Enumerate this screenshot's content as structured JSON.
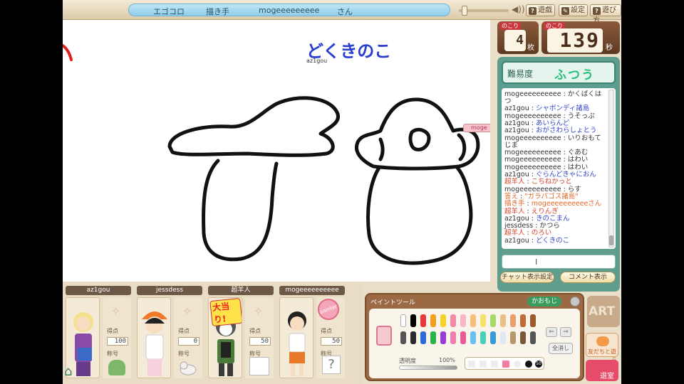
{
  "titlebar": {
    "app": "エゴコロ",
    "role": "描き手",
    "artist": "mogeeeeeeeee",
    "suffix": "さん"
  },
  "toolbar": {
    "help": "遊戯",
    "settings": "設定",
    "howto": "遊び方",
    "help_icon": "?",
    "settings_icon": "✎",
    "howto_icon": "?"
  },
  "counters": {
    "remaining_cards": {
      "caption": "のこり",
      "value": "4",
      "unit": "枚"
    },
    "remaining_time": {
      "caption": "のこり",
      "value": "139",
      "unit": "秒"
    }
  },
  "canvas": {
    "word": "どくきのこ",
    "drawer": "az1gou",
    "peek_tag": "moge"
  },
  "difficulty": {
    "label": "難易度",
    "value": "ふつう"
  },
  "chat": [
    {
      "who": "mogeeeeeeeeee",
      "msg": "かくばくはつ",
      "style": "normal"
    },
    {
      "who": "az1gou",
      "msg": "シャボンディ諸島",
      "style": "blue"
    },
    {
      "who": "mogeeeeeeeeee",
      "msg": "うそっぷ",
      "style": "normal"
    },
    {
      "who": "az1gou",
      "msg": "あいらんど",
      "style": "blue"
    },
    {
      "who": "az1gou",
      "msg": "おがさわらしょとう",
      "style": "blue"
    },
    {
      "who": "mogeeeeeeeeee",
      "msg": "いりおもてじま",
      "style": "normal"
    },
    {
      "who": "mogeeeeeeeeee",
      "msg": "ぐあむ",
      "style": "normal"
    },
    {
      "who": "mogeeeeeeeeee",
      "msg": "はわい",
      "style": "normal"
    },
    {
      "who": "mogeeeeeeeeee",
      "msg": "はわい",
      "style": "normal"
    },
    {
      "who": "az1gou",
      "msg": "ぐらんどきゃにおん",
      "style": "blue"
    },
    {
      "who": "超羊人",
      "msg": "こちねかっと",
      "style": "red"
    },
    {
      "who": "mogeeeeeeeeee",
      "msg": "らす",
      "style": "normal"
    },
    {
      "who": "答え",
      "msg": "\"ガラパゴス諸島\"",
      "style": "orange"
    },
    {
      "who": "描き手",
      "msg": "mogeeeeeeeeeeさん",
      "style": "orange"
    },
    {
      "who": "超羊人",
      "msg": "えりんぎ",
      "style": "red"
    },
    {
      "who": "az1gou",
      "msg": "きのこまん",
      "style": "blue"
    },
    {
      "who": "jessdess",
      "msg": "かつら",
      "style": "normal"
    },
    {
      "who": "超羊人",
      "msg": "のろい",
      "style": "red"
    },
    {
      "who": "az1gou",
      "msg": "どくきのこ",
      "style": "blue"
    }
  ],
  "chat_input": {
    "caret": "I"
  },
  "chat_buttons": {
    "settings": "チャット表示設定",
    "comments": "コメント表示"
  },
  "players": [
    {
      "name": "az1gou",
      "score_label": "得点",
      "score": "100",
      "title_label": "称号"
    },
    {
      "name": "jessdess",
      "score_label": "得点",
      "score": "0",
      "title_label": "称号"
    },
    {
      "name": "超羊人",
      "score_label": "得点",
      "score": "50",
      "title_label": "称号",
      "badge": "大当り!"
    },
    {
      "name": "mogeeeeeeeeee",
      "score_label": "得点",
      "score": "50",
      "title_label": "称号",
      "badge": "painter"
    }
  ],
  "mystery": "?",
  "paint_tool": {
    "title": "ペイントツール",
    "kaomoji": "かおもじ",
    "opacity_label": "透明度",
    "opacity_value": "100%",
    "opacity": 1.0,
    "clear": "全消し",
    "arrow_left": "⇐",
    "arrow_right": "⇒",
    "size_big": "50",
    "colors_top": [
      "#ffffff",
      "#000000",
      "#e83a3a",
      "#f0a020",
      "#f5d22a",
      "#f28aa8",
      "#f7b7c8",
      "#f5c07a",
      "#f3e36a",
      "#a8d86a",
      "#e8c08a",
      "#e8a070",
      "#c26a3a",
      "#9a5a2a"
    ],
    "colors_bottom": [
      "#555555",
      "#2a2a2a",
      "#2d6ad8",
      "#2ab44a",
      "#9a3ad8",
      "#f07fb0",
      "#e85a9a",
      "#6ac0f0",
      "#48d0b8",
      "#3a9ad8",
      "#e0e8f0",
      "#b89a6a",
      "#7a5a3a",
      "#555555"
    ]
  },
  "start_label": "ART",
  "friends_label": "友だちと遊ぶ",
  "leave_label": "退室",
  "colors": {
    "accent_teal": "#5f9d8f",
    "title_blue": "#2a3fd0",
    "brown": "#7b4e2e"
  }
}
